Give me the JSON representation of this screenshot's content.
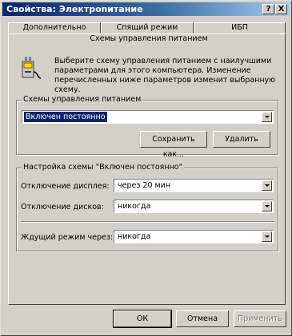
{
  "window": {
    "title": "Свойства: Электропитание"
  },
  "title_buttons": {
    "help": "?",
    "close": "X"
  },
  "tabs": [
    "Дополнительно",
    "Спящий режим",
    "ИБП"
  ],
  "active_tab": "Схемы управления питанием",
  "description": "Выберите схему управления питанием с наилучшими параметрами для этого компьютера. Изменение перечисленных ниже параметров изменит выбранную схему.",
  "schemes_group": {
    "label": "Схемы управления питанием",
    "selected": "Включен постоянно",
    "save_as_label": "Сохранить как...",
    "delete_label": "Удалить"
  },
  "settings_group": {
    "label": "Настройка схемы \"Включен постоянно\"",
    "monitor_label": "Отключение дисплея:",
    "monitor_value": "через 20 мин",
    "disks_label": "Отключение дисков:",
    "disks_value": "никогда",
    "standby_label": "Ждущий режим через:",
    "standby_value": "никогда"
  },
  "footer": {
    "ok_label": "ОК",
    "cancel_label": "Отмена",
    "apply_label": "Применить"
  },
  "icons": {
    "help": "help-icon",
    "close": "close-icon",
    "power": "power-plug-icon"
  }
}
